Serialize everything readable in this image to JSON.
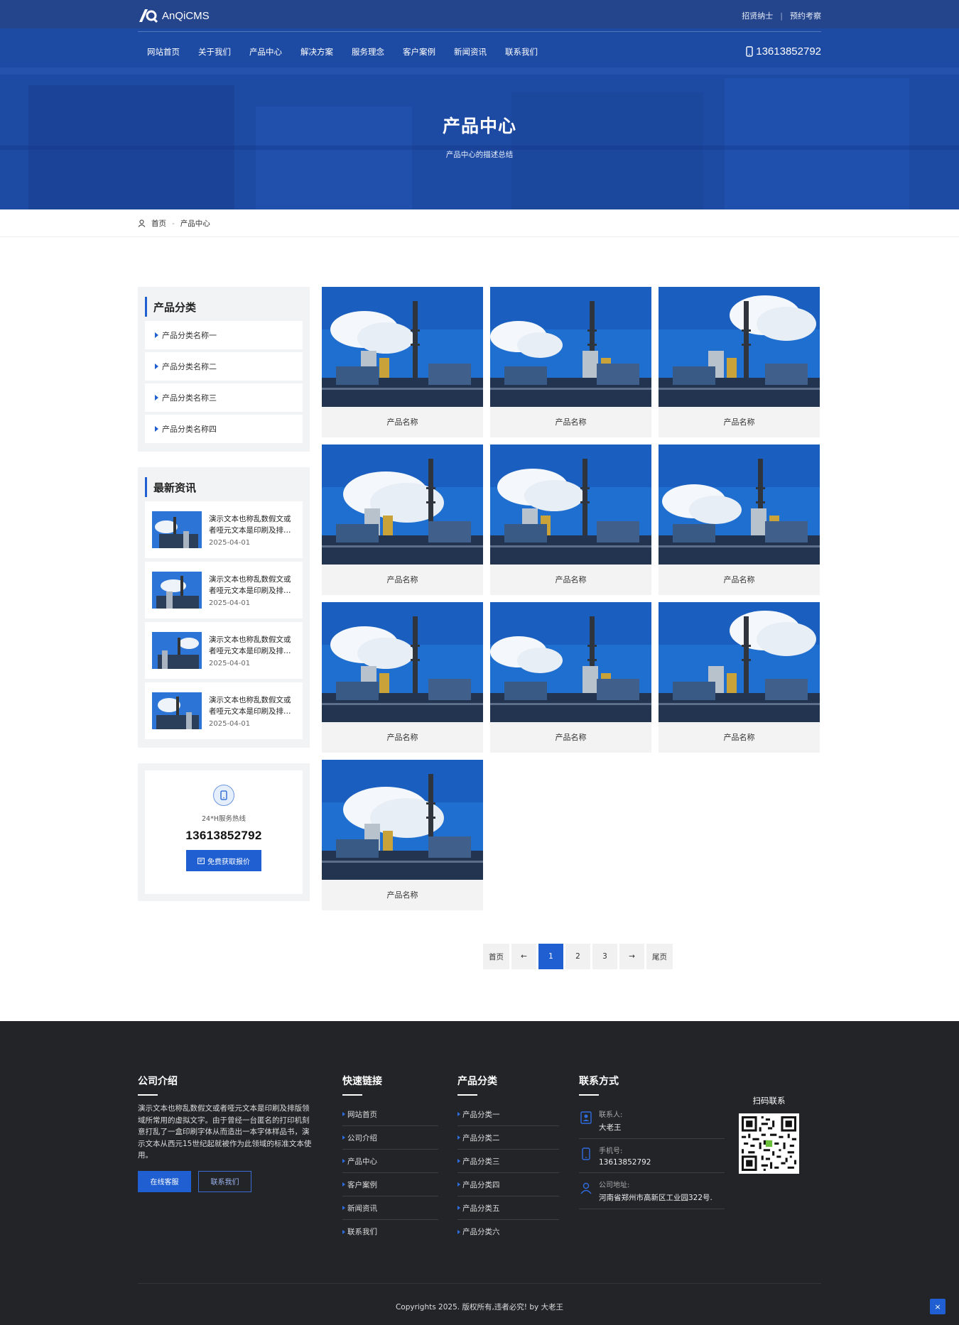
{
  "header": {
    "logo_text": "AnQiCMS",
    "top_links": [
      "招贤纳士",
      "预约考察"
    ],
    "nav": [
      "网站首页",
      "关于我们",
      "产品中心",
      "解决方案",
      "服务理念",
      "客户案例",
      "新闻资讯",
      "联系我们"
    ],
    "phone": "13613852792"
  },
  "hero": {
    "title": "产品中心",
    "subtitle": "产品中心的描述总结"
  },
  "breadcrumb": {
    "home": "首页",
    "sep": "-",
    "current": "产品中心"
  },
  "sidebar": {
    "categories_title": "产品分类",
    "categories": [
      "产品分类名称一",
      "产品分类名称二",
      "产品分类名称三",
      "产品分类名称四"
    ],
    "news_title": "最新资讯",
    "news": [
      {
        "title": "演示文本也称乱数假文或者哑元文本是印刷及排…",
        "date": "2025-04-01"
      },
      {
        "title": "演示文本也称乱数假文或者哑元文本是印刷及排…",
        "date": "2025-04-01"
      },
      {
        "title": "演示文本也称乱数假文或者哑元文本是印刷及排…",
        "date": "2025-04-01"
      },
      {
        "title": "演示文本也称乱数假文或者哑元文本是印刷及排…",
        "date": "2025-04-01"
      }
    ],
    "hotline_label": "24*H服务热线",
    "hotline": "13613852792",
    "quote_button": "免费获取报价"
  },
  "products": [
    "产品名称",
    "产品名称",
    "产品名称",
    "产品名称",
    "产品名称",
    "产品名称",
    "产品名称",
    "产品名称",
    "产品名称",
    "产品名称"
  ],
  "pagination": {
    "first": "首页",
    "prev": "←",
    "pages": [
      "1",
      "2",
      "3"
    ],
    "next": "→",
    "last": "尾页",
    "current": "1"
  },
  "footer": {
    "intro_title": "公司介绍",
    "intro_text": "演示文本也称乱数假文或者哑元文本是印刷及排版领域所常用的虚拟文字。由于曾经一台匿名的打印机刻意打乱了一盒印刷字体从而造出一本字体样品书，演示文本从西元15世纪起就被作为此领域的标准文本使用。",
    "btn_service": "在线客服",
    "btn_contact": "联系我们",
    "links_title": "快速链接",
    "links": [
      "网站首页",
      "公司介绍",
      "产品中心",
      "客户案例",
      "新闻资讯",
      "联系我们"
    ],
    "cats_title": "产品分类",
    "cats": [
      "产品分类一",
      "产品分类二",
      "产品分类三",
      "产品分类四",
      "产品分类五",
      "产品分类六"
    ],
    "contact_title": "联系方式",
    "contact_person_label": "联系人:",
    "contact_person": "大老王",
    "contact_phone_label": "手机号:",
    "contact_phone": "13613852792",
    "contact_addr_label": "公司地址:",
    "contact_addr": "河南省郑州市高新区工业园322号.",
    "qr_title": "扫码联系",
    "copyright": "Copyrights 2025. 版权所有,违者必究! by 大老王",
    "to_top": "×"
  },
  "colors": {
    "brand_blue": "#1f5fd1",
    "footer_bg": "#232427"
  }
}
